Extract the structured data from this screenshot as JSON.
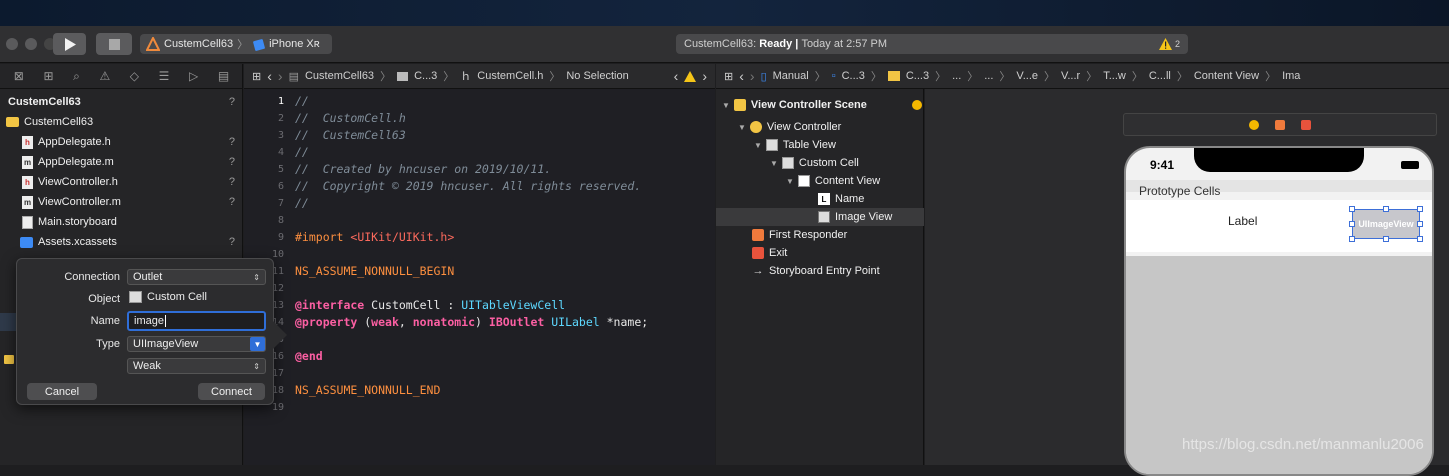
{
  "toolbar": {
    "scheme": "CustemCell63",
    "device": "iPhone Xʀ",
    "status_app": "CustemCell63:",
    "status_state": "Ready",
    "status_sep": "|",
    "status_time": "Today at 2:57 PM",
    "warning_count": "2"
  },
  "navigator": {
    "items": [
      {
        "label": "CustemCell63",
        "badge": "?"
      },
      {
        "label": "CustemCell63",
        "badge": ""
      },
      {
        "label": "AppDelegate.h",
        "badge": "?"
      },
      {
        "label": "AppDelegate.m",
        "badge": "?"
      },
      {
        "label": "ViewController.h",
        "badge": "?"
      },
      {
        "label": "ViewController.m",
        "badge": "?"
      },
      {
        "label": "Main.storyboard",
        "badge": ""
      },
      {
        "label": "Assets.xcassets",
        "badge": "?"
      }
    ]
  },
  "editor": {
    "jump": [
      "CustemCell63",
      "C...3",
      "CustemCell.h",
      "No Selection"
    ],
    "lines": [
      "1",
      "2",
      "3",
      "4",
      "5",
      "6",
      "7",
      "8",
      "9",
      "10",
      "11",
      "12",
      "13",
      "14",
      "15",
      "16",
      "17",
      "18",
      "19"
    ],
    "code": {
      "l1": "//",
      "l2": "//  CustomCell.h",
      "l3": "//  CustemCell63",
      "l4": "//",
      "l5": "//  Created by hncuser on 2019/10/11.",
      "l6": "//  Copyright © 2019 hncuser. All rights reserved.",
      "l7": "//",
      "l9a": "#import",
      "l9b": "<UIKit/UIKit.h>",
      "l11": "NS_ASSUME_NONNULL_BEGIN",
      "l13a": "@interface",
      "l13b": " CustomCell : ",
      "l13c": "UITableViewCell",
      "l14a": "@property",
      "l14b": " (",
      "l14c": "weak",
      "l14d": ", ",
      "l14e": "nonatomic",
      "l14f": ") ",
      "l14g": "IBOutlet",
      "l14h": " ",
      "l14i": "UILabel",
      "l14j": " *name;",
      "l16": "@end",
      "l18": "NS_ASSUME_NONNULL_END"
    }
  },
  "ib_jump": [
    "Manual",
    "C...3",
    "C...3",
    "...",
    "...",
    "V...e",
    "V...r",
    "T...w",
    "C...ll",
    "Content View",
    "Ima"
  ],
  "outline": {
    "scene": "View Controller Scene",
    "items": [
      "View Controller",
      "Table View",
      "Custom Cell",
      "Content View",
      "Name",
      "Image View",
      "First Responder",
      "Exit",
      "Storyboard Entry Point"
    ]
  },
  "phone": {
    "time": "9:41",
    "section": "Prototype Cells",
    "label": "Label",
    "image_view": "UIImageView"
  },
  "popover": {
    "connection_label": "Connection",
    "connection_value": "Outlet",
    "object_label": "Object",
    "object_value": "Custom Cell",
    "name_label": "Name",
    "name_value": "image",
    "type_label": "Type",
    "type_value": "UIImageView",
    "storage_value": "Weak",
    "cancel": "Cancel",
    "connect": "Connect"
  },
  "watermark": "https://blog.csdn.net/manmanlu2006",
  "colors": {
    "accent": "#2f6ed8",
    "warning": "#f5c518",
    "comment": "#7f8c98",
    "keyword": "#fc5fa3"
  }
}
